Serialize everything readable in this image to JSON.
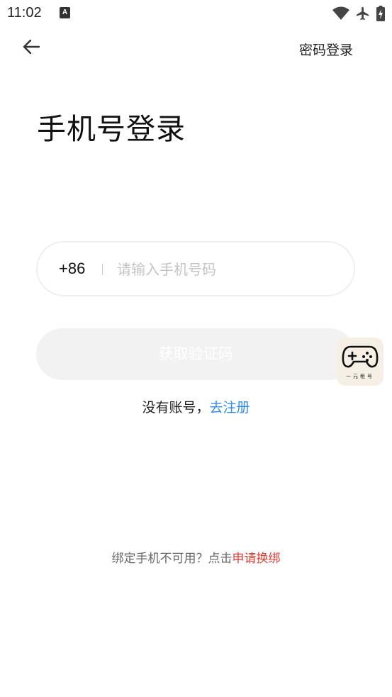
{
  "status_bar": {
    "time": "11:02",
    "app_icon_letter": "A",
    "icons": [
      "wifi-icon",
      "airplane-mode-icon",
      "battery-charging-icon"
    ]
  },
  "header": {
    "back_icon": "arrow-left-icon",
    "password_login_label": "密码登录"
  },
  "page": {
    "title": "手机号登录"
  },
  "phone_field": {
    "country_code": "+86",
    "value": "",
    "placeholder": "请输入手机号码"
  },
  "code_button": {
    "label": "获取验证码"
  },
  "signup": {
    "prefix": "没有账号，",
    "link": "去注册"
  },
  "rebind": {
    "prefix": "绑定手机不可用？点击",
    "link": "申请换绑"
  },
  "floating_widget": {
    "icon": "gamepad-icon",
    "label": "一元租号"
  },
  "colors": {
    "link_blue": "#2f8cf0",
    "link_red": "#e8392f",
    "button_disabled_bg": "#f2f2f2",
    "placeholder_gray": "#c4c4c4"
  }
}
